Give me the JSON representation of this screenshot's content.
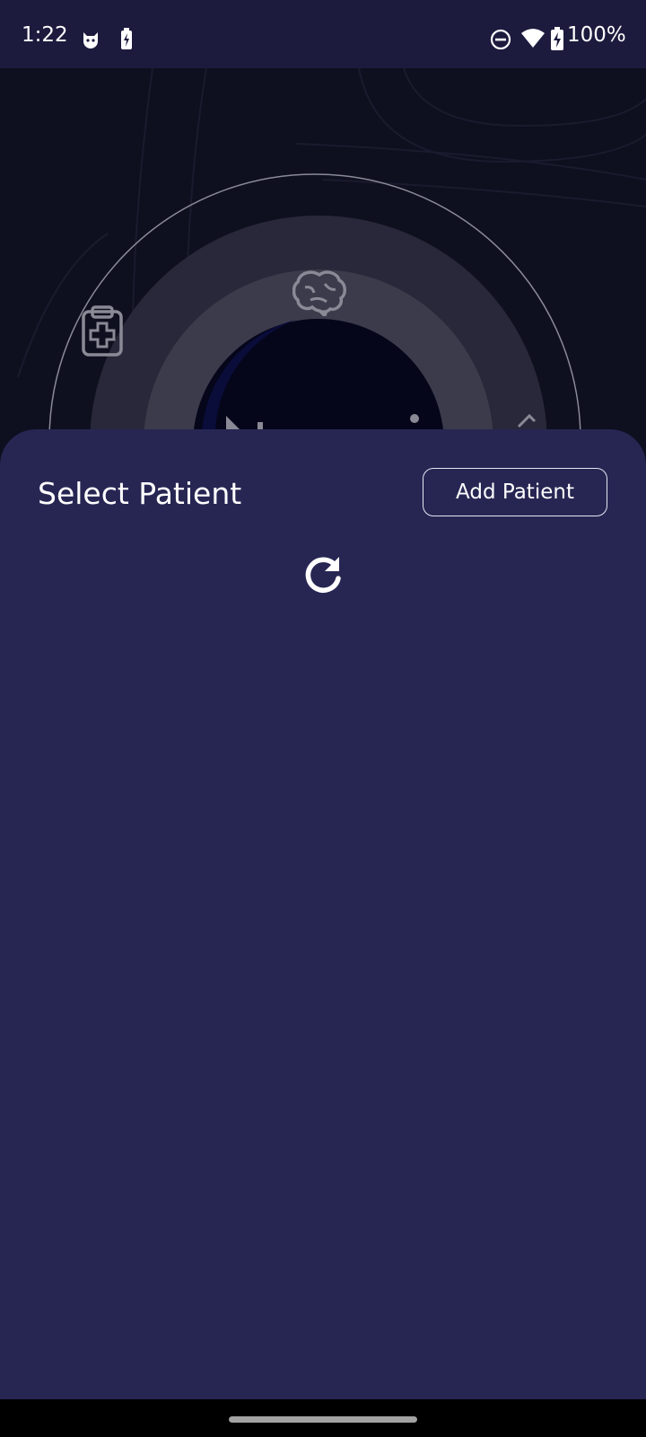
{
  "status_bar": {
    "time": "1:22",
    "battery_percent": "100%",
    "left_icons": [
      "cat-face-icon",
      "battery-saver-icon"
    ],
    "right_icons": [
      "do-not-disturb-icon",
      "wifi-icon",
      "battery-charging-icon"
    ]
  },
  "background": {
    "icons": [
      "clipboard-medical-icon",
      "brain-icon"
    ]
  },
  "sheet": {
    "title": "Select Patient",
    "add_button_label": "Add Patient"
  },
  "colors": {
    "status_bar": "#1c1b3e",
    "sheet": "#272653",
    "background": "#0e0f1f"
  }
}
